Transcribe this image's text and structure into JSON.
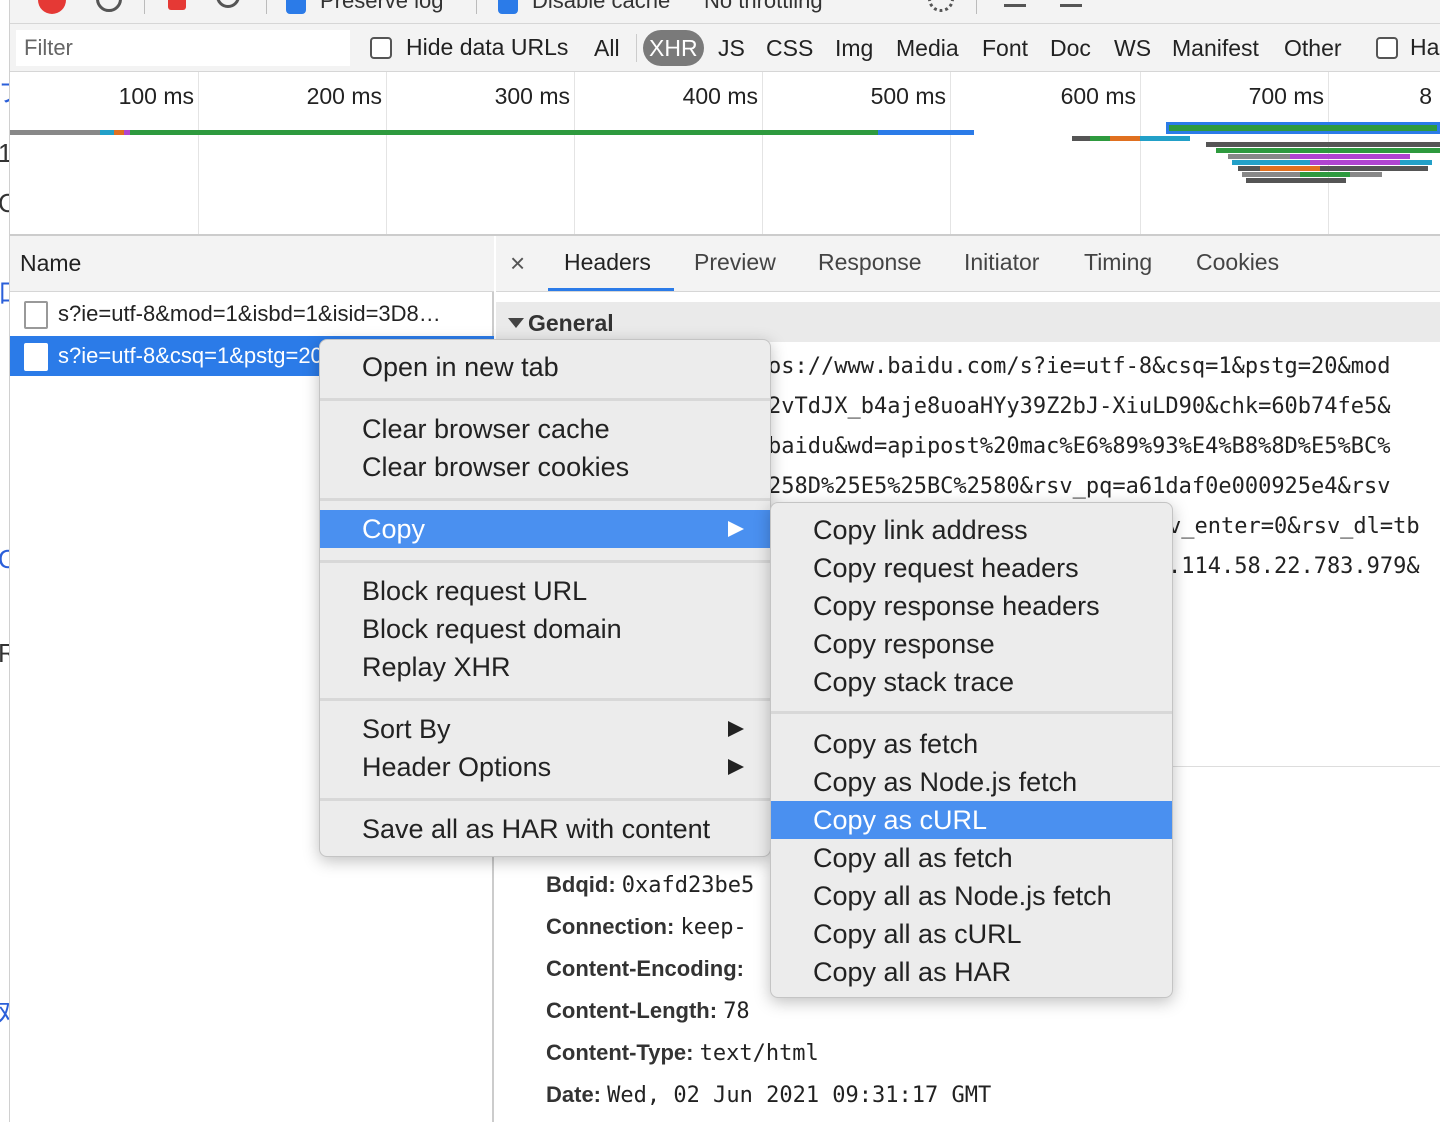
{
  "toolbar": {
    "preserve_log": "Preserve log",
    "disable_cache": "Disable cache",
    "throttling": "No throttling"
  },
  "filterbar": {
    "filter_placeholder": "Filter",
    "hide_data_urls": "Hide data URLs",
    "types": [
      "All",
      "XHR",
      "JS",
      "CSS",
      "Img",
      "Media",
      "Font",
      "Doc",
      "WS",
      "Manifest",
      "Other"
    ],
    "active_type": "XHR",
    "last_checkbox": "Ha"
  },
  "overview": {
    "ticks": [
      "100 ms",
      "200 ms",
      "300 ms",
      "400 ms",
      "500 ms",
      "600 ms",
      "700 ms",
      "8"
    ]
  },
  "reqlist": {
    "header": "Name",
    "rows": [
      "s?ie=utf-8&mod=1&isbd=1&isid=3D8…",
      "s?ie=utf-8&csq=1&pstg=20&mod=2"
    ]
  },
  "details": {
    "close": "×",
    "tabs": [
      "Headers",
      "Preview",
      "Response",
      "Initiator",
      "Timing",
      "Cookies"
    ],
    "active_tab": "Headers",
    "general_title": "General",
    "general_lines": [
      "os://www.baidu.com/s?ie=utf-8&csq=1&pstg=20&mod",
      "2vTdJX_b4aje8uoaHYy39Z2bJ-XiuLD90&chk=60b74fe5&",
      "baidu&wd=apipost%20mac%E6%89%93%E4%B8%8D%E5%BC%",
      "258D%25E5%25BC%2580&rsv_pq=a61daf0e000925e4&rsv",
      "v_enter=0&rsv_dl=tb",
      ".114.58.22.783.979&"
    ],
    "response_headers": [
      {
        "name": "Bdqid:",
        "value": "0xafd23be5"
      },
      {
        "name": "Connection:",
        "value": "keep-"
      },
      {
        "name": "Content-Encoding:",
        "value": ""
      },
      {
        "name": "Content-Length:",
        "value": "78"
      },
      {
        "name": "Content-Type:",
        "value": "text/html"
      },
      {
        "name": "Date:",
        "value": "Wed, 02 Jun 2021 09:31:17 GMT"
      }
    ]
  },
  "context_menu": {
    "items": [
      "Open in new tab",
      "Clear browser cache",
      "Clear browser cookies",
      "Copy",
      "Block request URL",
      "Block request domain",
      "Replay XHR",
      "Sort By",
      "Header Options",
      "Save all as HAR with content"
    ],
    "highlighted": "Copy"
  },
  "copy_submenu": {
    "items": [
      "Copy link address",
      "Copy request headers",
      "Copy response headers",
      "Copy response",
      "Copy stack trace",
      "Copy as fetch",
      "Copy as Node.js fetch",
      "Copy as cURL",
      "Copy all as fetch",
      "Copy all as Node.js fetch",
      "Copy all as cURL",
      "Copy all as HAR"
    ],
    "highlighted": "Copy as cURL"
  },
  "colors": {
    "accent": "#2b7be8",
    "menu_highlight": "#4a90f0",
    "record": "#e53935"
  }
}
